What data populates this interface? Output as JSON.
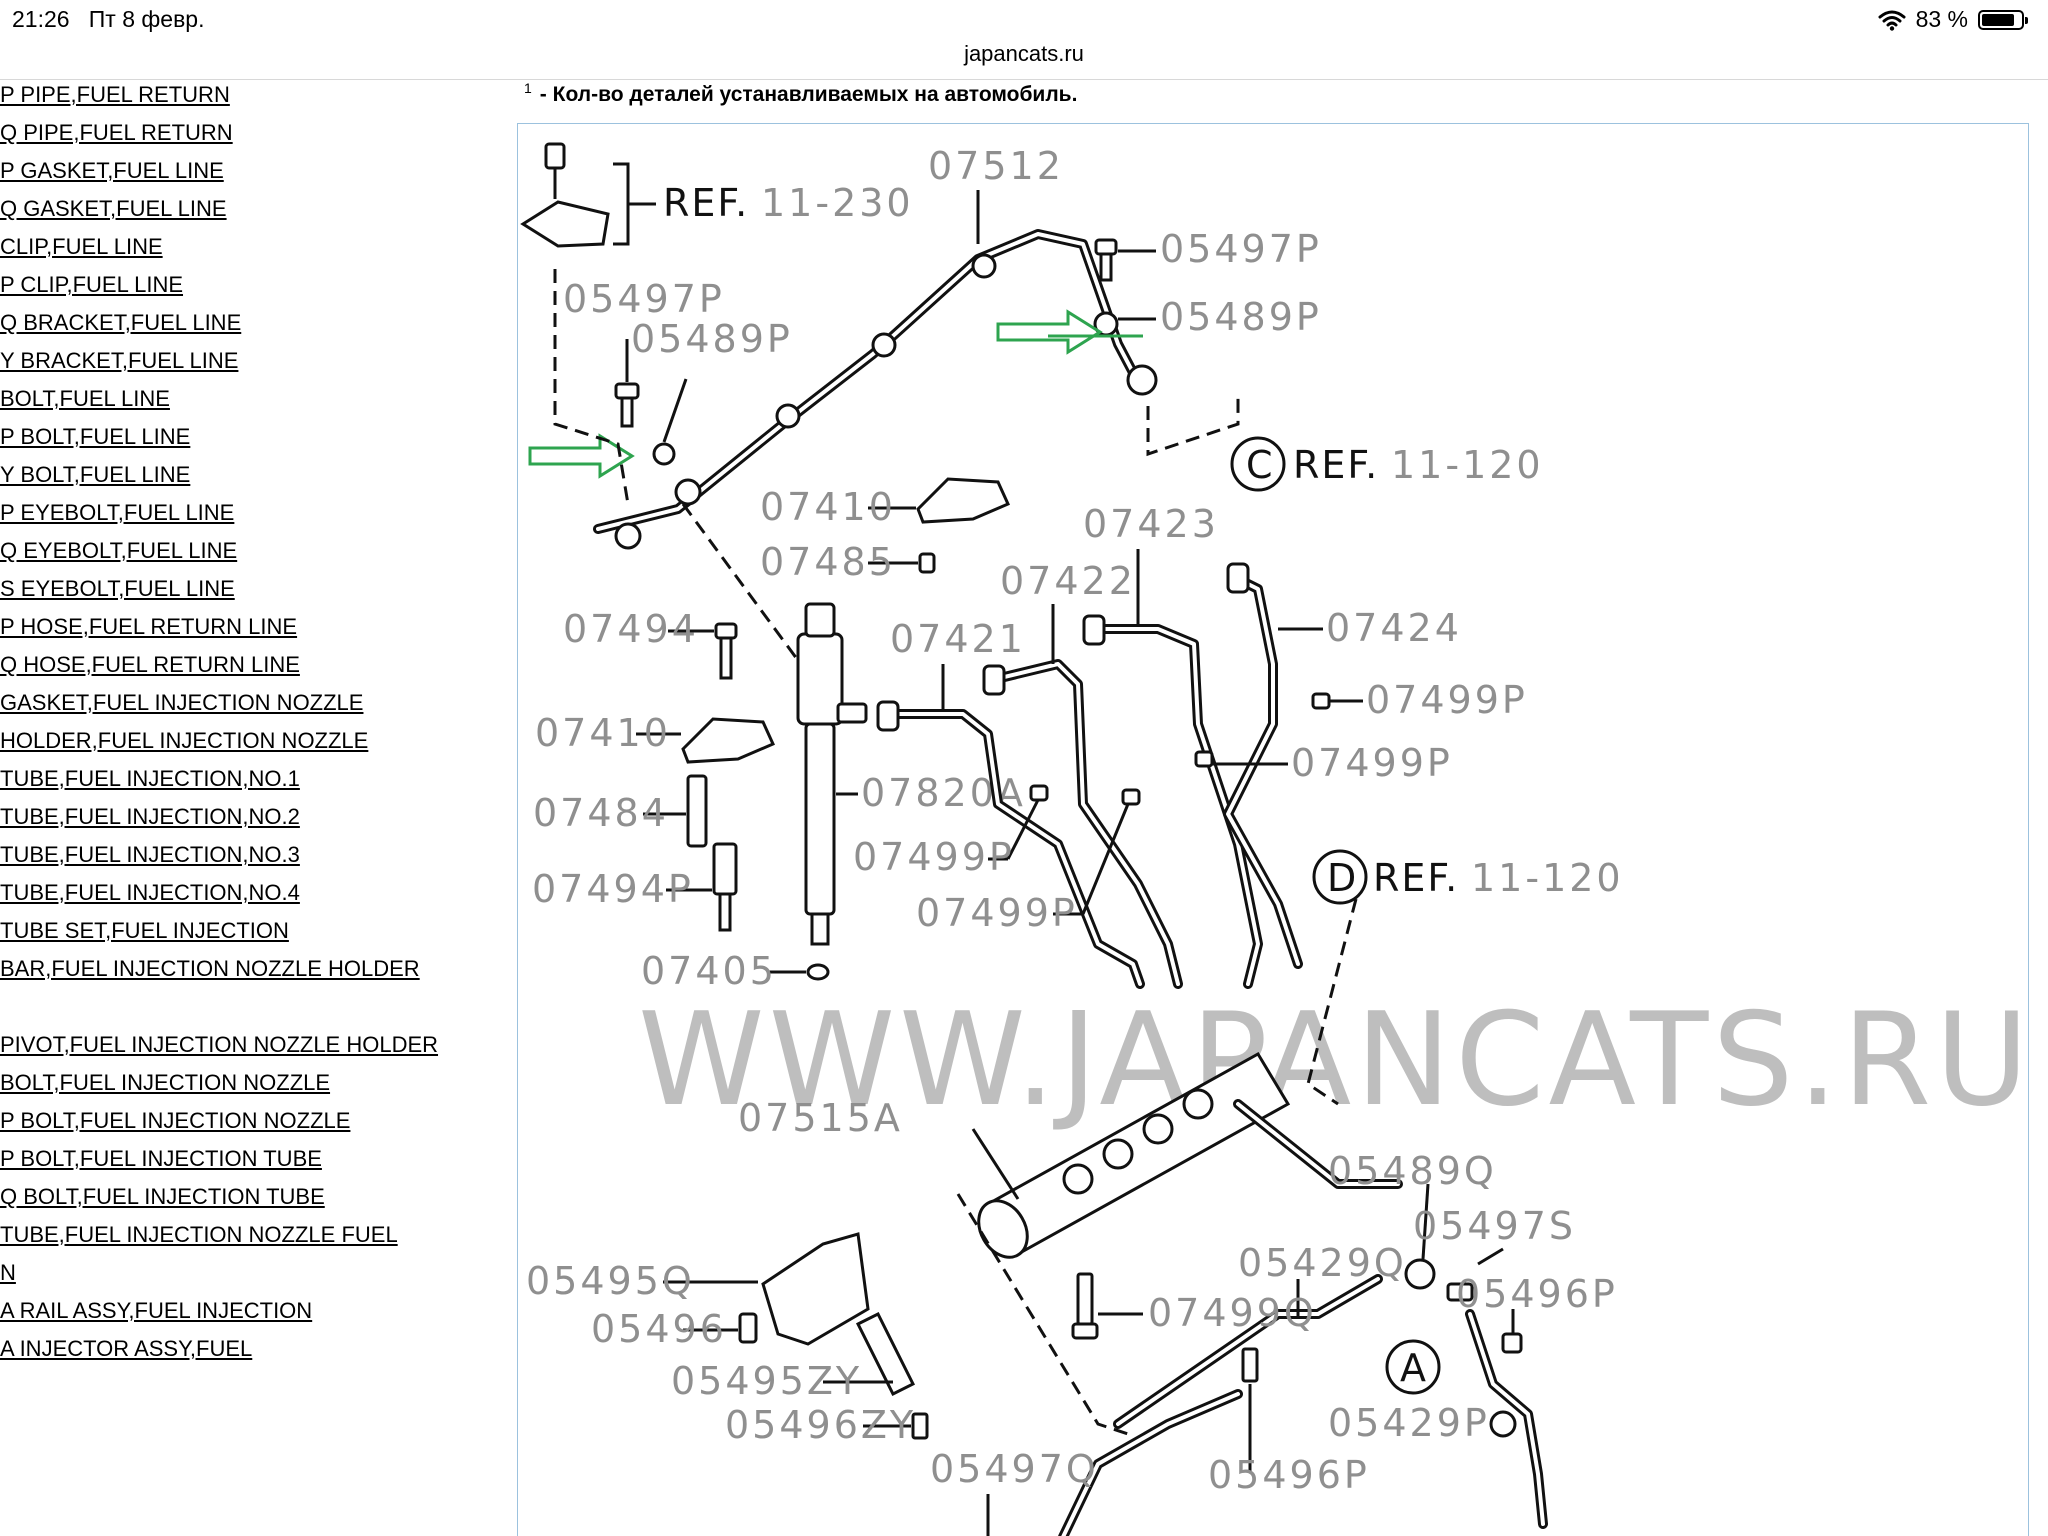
{
  "status_bar": {
    "time": "21:26",
    "date": "Пт 8 февр.",
    "battery": "83 %",
    "battery_level": 0.83
  },
  "browser": {
    "url": "japancats.ru"
  },
  "parts_list": [
    "P PIPE,FUEL RETURN",
    "Q PIPE,FUEL RETURN",
    "P GASKET,FUEL LINE",
    "Q GASKET,FUEL LINE",
    "CLIP,FUEL LINE",
    "P CLIP,FUEL LINE",
    "Q BRACKET,FUEL LINE",
    "Y BRACKET,FUEL LINE",
    "BOLT,FUEL LINE",
    "P BOLT,FUEL LINE",
    "Y BOLT,FUEL LINE",
    "P EYEBOLT,FUEL LINE",
    "Q EYEBOLT,FUEL LINE",
    "S EYEBOLT,FUEL LINE",
    "P HOSE,FUEL RETURN LINE",
    "Q HOSE,FUEL RETURN LINE",
    "GASKET,FUEL INJECTION NOZZLE",
    "HOLDER,FUEL INJECTION NOZZLE",
    "TUBE,FUEL INJECTION,NO.1",
    "TUBE,FUEL INJECTION,NO.2",
    "TUBE,FUEL INJECTION,NO.3",
    "TUBE,FUEL INJECTION,NO.4",
    "TUBE SET,FUEL INJECTION",
    "BAR,FUEL INJECTION NOZZLE HOLDER",
    "",
    "PIVOT,FUEL INJECTION NOZZLE HOLDER",
    "BOLT,FUEL INJECTION NOZZLE",
    "P BOLT,FUEL INJECTION NOZZLE",
    "P BOLT,FUEL INJECTION TUBE",
    "Q BOLT,FUEL INJECTION TUBE",
    "TUBE,FUEL INJECTION NOZZLE FUEL",
    "N",
    "A RAIL ASSY,FUEL INJECTION",
    "A INJECTOR ASSY,FUEL"
  ],
  "note": {
    "superscript": "1",
    "text": "- Кол-во деталей устанавливаемых на автомобиль."
  },
  "diagram": {
    "watermark": "WWW.JAPANCATS.RU",
    "refs": {
      "ref_11_230": {
        "prefix": "REF.",
        "code": "11-230"
      },
      "ref_c": {
        "circle": "C",
        "prefix": "REF.",
        "code": "11-120"
      },
      "ref_d": {
        "circle": "D",
        "prefix": "REF.",
        "code": "11-120"
      },
      "circle_a": "A"
    },
    "labels": {
      "p07512": "07512",
      "p05497p_a": "05497P",
      "p05489p_a": "05489P",
      "p05497p_b": "05497P",
      "p05489p_b": "05489P",
      "p07410_a": "07410",
      "p07485": "07485",
      "p07423": "07423",
      "p07422": "07422",
      "p07494": "07494",
      "p07421": "07421",
      "p07424": "07424",
      "p07499p_a": "07499P",
      "p07410_b": "07410",
      "p07499p_b": "07499P",
      "p07820a": "07820A",
      "p07484": "07484",
      "p07499p_c": "07499P",
      "p07494p": "07494P",
      "p07499p_d": "07499P",
      "p07405": "07405",
      "p05489q": "05489Q",
      "p05497s": "05497S",
      "p07515a": "07515A",
      "p05429q": "05429Q",
      "p07499q": "07499Q",
      "p05495q": "05495Q",
      "p05496p_a": "05496P",
      "p05496": "05496",
      "p05495zy": "05495ZY",
      "p05429p": "05429P",
      "p05496zy": "05496ZY",
      "p05497q": "05497Q",
      "p05496p_b": "05496P"
    }
  }
}
